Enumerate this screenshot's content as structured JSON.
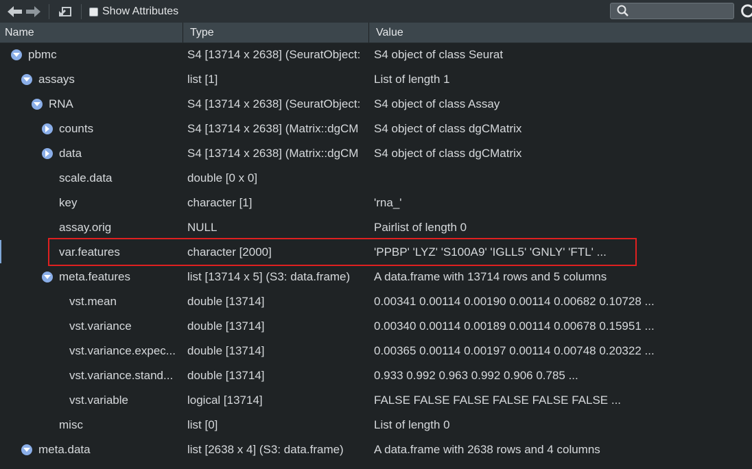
{
  "toolbar": {
    "back_icon": "arrow-left-icon",
    "forward_icon": "arrow-right-icon",
    "popout_icon": "popout-icon",
    "show_attributes_label": "Show Attributes",
    "show_attributes_checked": false,
    "search_placeholder": "",
    "search_icon": "search-icon",
    "refresh_icon": "refresh-icon"
  },
  "columns": {
    "name": "Name",
    "type": "Type",
    "value": "Value"
  },
  "colors": {
    "background": "#1f2325",
    "header": "#3c464c",
    "toggle": "#8aaee8",
    "highlight": "#e02020"
  },
  "rows": [
    {
      "name": "pbmc",
      "type": "S4 [13714 x 2638] (SeuratObject:",
      "value": "S4 object of class Seurat",
      "depth": 0,
      "toggle": "expanded"
    },
    {
      "name": "assays",
      "type": "list [1]",
      "value": "List of length 1",
      "depth": 1,
      "toggle": "expanded"
    },
    {
      "name": "RNA",
      "type": "S4 [13714 x 2638] (SeuratObject:",
      "value": "S4 object of class Assay",
      "depth": 2,
      "toggle": "expanded"
    },
    {
      "name": "counts",
      "type": "S4 [13714 x 2638] (Matrix::dgCM",
      "value": "S4 object of class dgCMatrix",
      "depth": 3,
      "toggle": "collapsed"
    },
    {
      "name": "data",
      "type": "S4 [13714 x 2638] (Matrix::dgCM",
      "value": "S4 object of class dgCMatrix",
      "depth": 3,
      "toggle": "collapsed"
    },
    {
      "name": "scale.data",
      "type": "double [0 x 0]",
      "value": "",
      "depth": 3,
      "toggle": "none"
    },
    {
      "name": "key",
      "type": "character [1]",
      "value": "'rna_'",
      "depth": 3,
      "toggle": "none"
    },
    {
      "name": "assay.orig",
      "type": "NULL",
      "value": "Pairlist of length 0",
      "depth": 3,
      "toggle": "none"
    },
    {
      "name": "var.features",
      "type": "character [2000]",
      "value": "'PPBP' 'LYZ' 'S100A9' 'IGLL5' 'GNLY' 'FTL' ...",
      "depth": 3,
      "toggle": "none"
    },
    {
      "name": "meta.features",
      "type": "list [13714 x 5] (S3: data.frame)",
      "value": "A data.frame with 13714 rows and 5 columns",
      "depth": 3,
      "toggle": "expanded"
    },
    {
      "name": "vst.mean",
      "type": "double [13714]",
      "value": "0.00341 0.00114 0.00190 0.00114 0.00682 0.10728 ...",
      "depth": 4,
      "toggle": "none"
    },
    {
      "name": "vst.variance",
      "type": "double [13714]",
      "value": "0.00340 0.00114 0.00189 0.00114 0.00678 0.15951 ...",
      "depth": 4,
      "toggle": "none"
    },
    {
      "name": "vst.variance.expec...",
      "type": "double [13714]",
      "value": "0.00365 0.00114 0.00197 0.00114 0.00748 0.20322 ...",
      "depth": 4,
      "toggle": "none"
    },
    {
      "name": "vst.variance.stand...",
      "type": "double [13714]",
      "value": "0.933 0.992 0.963 0.992 0.906 0.785 ...",
      "depth": 4,
      "toggle": "none"
    },
    {
      "name": "vst.variable",
      "type": "logical [13714]",
      "value": "FALSE FALSE FALSE FALSE FALSE FALSE ...",
      "depth": 4,
      "toggle": "none"
    },
    {
      "name": "misc",
      "type": "list [0]",
      "value": "List of length 0",
      "depth": 3,
      "toggle": "none"
    },
    {
      "name": "meta.data",
      "type": "list [2638 x 4] (S3: data.frame)",
      "value": "A data.frame with 2638 rows and 4 columns",
      "depth": 1,
      "toggle": "expanded"
    }
  ],
  "highlighted_row": "var.features"
}
